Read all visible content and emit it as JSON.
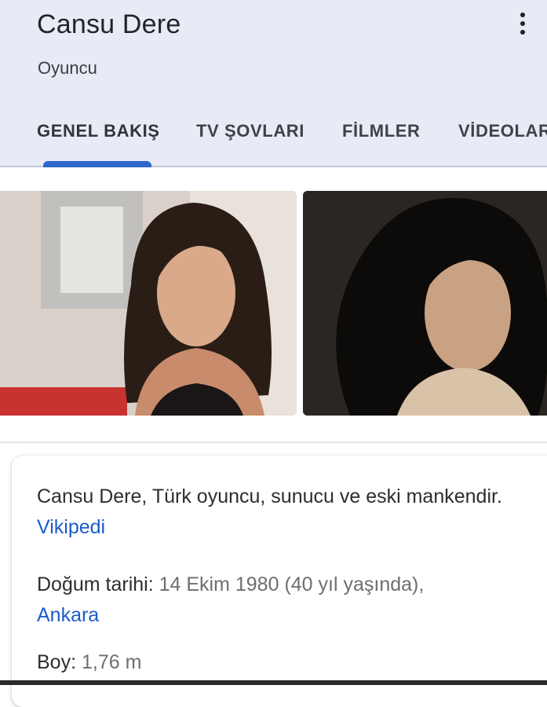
{
  "header": {
    "title": "Cansu Dere",
    "subtitle": "Oyuncu",
    "menu_icon": "more-vert-icon",
    "background_color": "#e8ebf6",
    "accent_color": "#2f66c9"
  },
  "tabs": [
    {
      "label": "GENEL BAKIŞ",
      "active": true
    },
    {
      "label": "TV ŞOVLARI",
      "active": false
    },
    {
      "label": "FİLMLER",
      "active": false
    },
    {
      "label": "VİDEOLAR",
      "active": false
    }
  ],
  "images": [
    {
      "name": "photo-1"
    },
    {
      "name": "photo-2"
    }
  ],
  "description": {
    "text": "Cansu Dere, Türk oyuncu, sunucu ve eski mankendir.",
    "source_link": "Vikipedi",
    "link_color": "#1a5dc8"
  },
  "facts": {
    "birth": {
      "label": "Doğum tarihi:",
      "value": "14 Ekim 1980 (40 yıl yaşında),",
      "place_link": "Ankara"
    },
    "height": {
      "label": "Boy:",
      "value": "1,76 m"
    }
  }
}
